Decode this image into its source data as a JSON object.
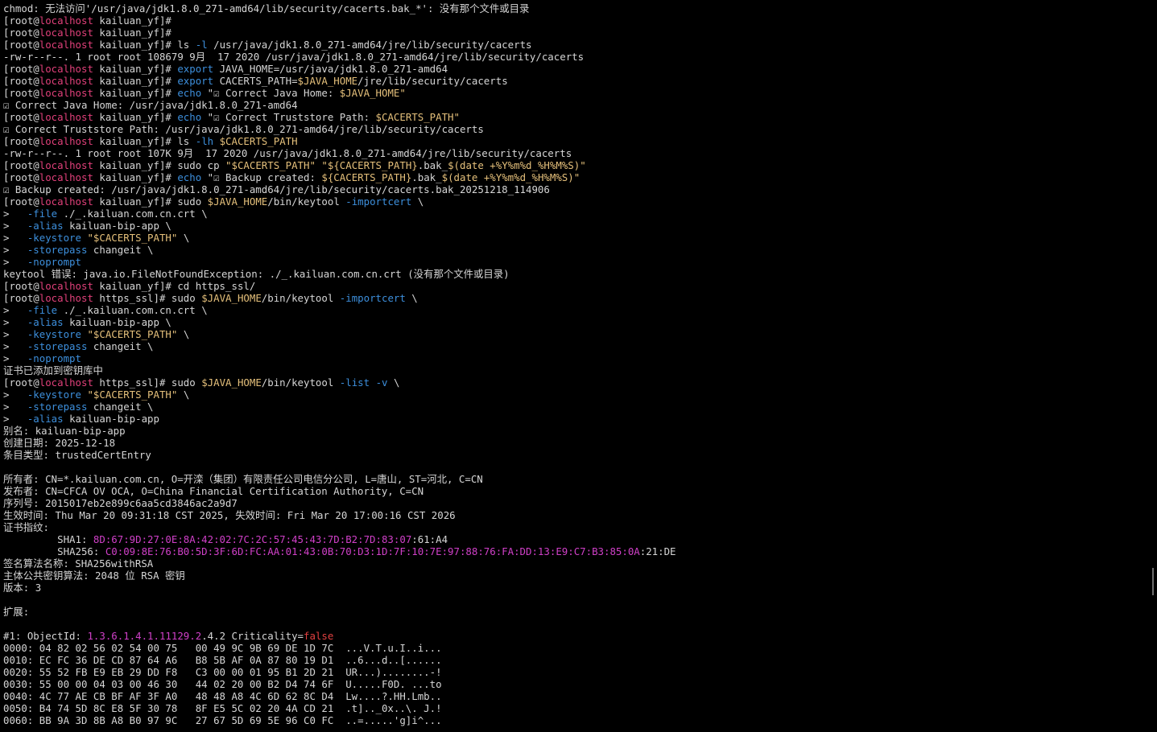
{
  "terminal": {
    "lines": [
      [
        {
          "t": "chmod: 无法访问'/usr/java/jdk1.8.0_271-amd64/lib/security/cacerts.bak_*': 没有那个文件或目录"
        }
      ],
      [
        {
          "t": "[root@"
        },
        {
          "t": "localhost",
          "c": "host"
        },
        {
          "t": " kailuan_yf]#"
        }
      ],
      [
        {
          "t": "[root@"
        },
        {
          "t": "localhost",
          "c": "host"
        },
        {
          "t": " kailuan_yf]#"
        }
      ],
      [
        {
          "t": "[root@"
        },
        {
          "t": "localhost",
          "c": "host"
        },
        {
          "t": " kailuan_yf]# ls "
        },
        {
          "t": "-l",
          "c": "cmd"
        },
        {
          "t": " /usr/java/jdk1.8.0_271-amd64/jre/lib/security/cacerts"
        }
      ],
      [
        {
          "t": "-rw-r--r--. 1 root root 108679 9月  17 2020 /usr/java/jdk1.8.0_271-amd64/jre/lib/security/cacerts"
        }
      ],
      [
        {
          "t": "[root@"
        },
        {
          "t": "localhost",
          "c": "host"
        },
        {
          "t": " kailuan_yf]# "
        },
        {
          "t": "export",
          "c": "cmd"
        },
        {
          "t": " JAVA_HOME=/usr/java/jdk1.8.0_271-amd64"
        }
      ],
      [
        {
          "t": "[root@"
        },
        {
          "t": "localhost",
          "c": "host"
        },
        {
          "t": " kailuan_yf]# "
        },
        {
          "t": "export",
          "c": "cmd"
        },
        {
          "t": " CACERTS_PATH="
        },
        {
          "t": "$JAVA_HOME",
          "c": "var"
        },
        {
          "t": "/jre/lib/security/cacerts"
        }
      ],
      [
        {
          "t": "[root@"
        },
        {
          "t": "localhost",
          "c": "host"
        },
        {
          "t": " kailuan_yf]# "
        },
        {
          "t": "echo",
          "c": "cmd"
        },
        {
          "t": " \"☑ Correct Java Home: "
        },
        {
          "t": "$JAVA_HOME\"",
          "c": "str"
        }
      ],
      [
        {
          "t": "☑ Correct Java Home: /usr/java/jdk1.8.0_271-amd64"
        }
      ],
      [
        {
          "t": "[root@"
        },
        {
          "t": "localhost",
          "c": "host"
        },
        {
          "t": " kailuan_yf]# "
        },
        {
          "t": "echo",
          "c": "cmd"
        },
        {
          "t": " \"☑ Correct Truststore Path: "
        },
        {
          "t": "$CACERTS_PATH\"",
          "c": "str"
        }
      ],
      [
        {
          "t": "☑ Correct Truststore Path: /usr/java/jdk1.8.0_271-amd64/jre/lib/security/cacerts"
        }
      ],
      [
        {
          "t": "[root@"
        },
        {
          "t": "localhost",
          "c": "host"
        },
        {
          "t": " kailuan_yf]# ls "
        },
        {
          "t": "-lh",
          "c": "cmd"
        },
        {
          "t": " "
        },
        {
          "t": "$CACERTS_PATH",
          "c": "var"
        }
      ],
      [
        {
          "t": "-rw-r--r--. 1 root root 107K 9月  17 2020 /usr/java/jdk1.8.0_271-amd64/jre/lib/security/cacerts"
        }
      ],
      [
        {
          "t": "[root@"
        },
        {
          "t": "localhost",
          "c": "host"
        },
        {
          "t": " kailuan_yf]# sudo cp "
        },
        {
          "t": "\"$CACERTS_PATH\"",
          "c": "str"
        },
        {
          "t": " "
        },
        {
          "t": "\"${CACERTS_PATH}",
          "c": "str"
        },
        {
          "t": ".bak_"
        },
        {
          "t": "$(date +%Y%m%d_%H%M%S)\"",
          "c": "str"
        }
      ],
      [
        {
          "t": "[root@"
        },
        {
          "t": "localhost",
          "c": "host"
        },
        {
          "t": " kailuan_yf]# "
        },
        {
          "t": "echo",
          "c": "cmd"
        },
        {
          "t": " \"☑ Backup created: "
        },
        {
          "t": "${CACERTS_PATH}",
          "c": "str"
        },
        {
          "t": ".bak_"
        },
        {
          "t": "$(date +%Y%m%d_%H%M%S)\"",
          "c": "str"
        }
      ],
      [
        {
          "t": "☑ Backup created: /usr/java/jdk1.8.0_271-amd64/jre/lib/security/cacerts.bak_20251218_114906"
        }
      ],
      [
        {
          "t": "[root@"
        },
        {
          "t": "localhost",
          "c": "host"
        },
        {
          "t": " kailuan_yf]# sudo "
        },
        {
          "t": "$JAVA_HOME",
          "c": "var"
        },
        {
          "t": "/bin/keytool "
        },
        {
          "t": "-importcert",
          "c": "cmd"
        },
        {
          "t": " \\"
        }
      ],
      [
        {
          "t": ">   "
        },
        {
          "t": "-file",
          "c": "cmd"
        },
        {
          "t": " ./_.kailuan.com.cn.crt \\"
        }
      ],
      [
        {
          "t": ">   "
        },
        {
          "t": "-alias",
          "c": "cmd"
        },
        {
          "t": " kailuan-bip-app \\"
        }
      ],
      [
        {
          "t": ">   "
        },
        {
          "t": "-keystore",
          "c": "cmd"
        },
        {
          "t": " "
        },
        {
          "t": "\"$CACERTS_PATH\"",
          "c": "str"
        },
        {
          "t": " \\"
        }
      ],
      [
        {
          "t": ">   "
        },
        {
          "t": "-storepass",
          "c": "cmd"
        },
        {
          "t": " changeit \\"
        }
      ],
      [
        {
          "t": ">   "
        },
        {
          "t": "-noprompt",
          "c": "cmd"
        }
      ],
      [
        {
          "t": "keytool 错误: java.io.FileNotFoundException: ./_.kailuan.com.cn.crt (没有那个文件或目录)"
        }
      ],
      [
        {
          "t": "[root@"
        },
        {
          "t": "localhost",
          "c": "host"
        },
        {
          "t": " kailuan_yf]# cd https_ssl/"
        }
      ],
      [
        {
          "t": "[root@"
        },
        {
          "t": "localhost",
          "c": "host"
        },
        {
          "t": " https_ssl]# sudo "
        },
        {
          "t": "$JAVA_HOME",
          "c": "var"
        },
        {
          "t": "/bin/keytool "
        },
        {
          "t": "-importcert",
          "c": "cmd"
        },
        {
          "t": " \\"
        }
      ],
      [
        {
          "t": ">   "
        },
        {
          "t": "-file",
          "c": "cmd"
        },
        {
          "t": " ./_.kailuan.com.cn.crt \\"
        }
      ],
      [
        {
          "t": ">   "
        },
        {
          "t": "-alias",
          "c": "cmd"
        },
        {
          "t": " kailuan-bip-app \\"
        }
      ],
      [
        {
          "t": ">   "
        },
        {
          "t": "-keystore",
          "c": "cmd"
        },
        {
          "t": " "
        },
        {
          "t": "\"$CACERTS_PATH\"",
          "c": "str"
        },
        {
          "t": " \\"
        }
      ],
      [
        {
          "t": ">   "
        },
        {
          "t": "-storepass",
          "c": "cmd"
        },
        {
          "t": " changeit \\"
        }
      ],
      [
        {
          "t": ">   "
        },
        {
          "t": "-noprompt",
          "c": "cmd"
        }
      ],
      [
        {
          "t": "证书已添加到密钥库中"
        }
      ],
      [
        {
          "t": "[root@"
        },
        {
          "t": "localhost",
          "c": "host"
        },
        {
          "t": " https_ssl]# sudo "
        },
        {
          "t": "$JAVA_HOME",
          "c": "var"
        },
        {
          "t": "/bin/keytool "
        },
        {
          "t": "-list",
          "c": "cmd"
        },
        {
          "t": " "
        },
        {
          "t": "-v",
          "c": "cmd"
        },
        {
          "t": " \\"
        }
      ],
      [
        {
          "t": ">   "
        },
        {
          "t": "-keystore",
          "c": "cmd"
        },
        {
          "t": " "
        },
        {
          "t": "\"$CACERTS_PATH\"",
          "c": "str"
        },
        {
          "t": " \\"
        }
      ],
      [
        {
          "t": ">   "
        },
        {
          "t": "-storepass",
          "c": "cmd"
        },
        {
          "t": " changeit \\"
        }
      ],
      [
        {
          "t": ">   "
        },
        {
          "t": "-alias",
          "c": "cmd"
        },
        {
          "t": " kailuan-bip-app"
        }
      ],
      [
        {
          "t": "别名: kailuan-bip-app"
        }
      ],
      [
        {
          "t": "创建日期: 2025-12-18"
        }
      ],
      [
        {
          "t": "条目类型: trustedCertEntry"
        }
      ],
      [
        {
          "t": ""
        }
      ],
      [
        {
          "t": "所有者: CN=*.kailuan.com.cn, O=开滦（集团）有限责任公司电信分公司, L=唐山, ST=河北, C=CN"
        }
      ],
      [
        {
          "t": "发布者: CN=CFCA OV OCA, O=China Financial Certification Authority, C=CN"
        }
      ],
      [
        {
          "t": "序列号: 2015017eb2e899c6aa5cd3846ac2a9d7"
        }
      ],
      [
        {
          "t": "生效时间: Thu Mar 20 09:31:18 CST 2025, 失效时间: Fri Mar 20 17:00:16 CST 2026"
        }
      ],
      [
        {
          "t": "证书指纹:"
        }
      ],
      [
        {
          "t": "         SHA1: "
        },
        {
          "t": "8D:67:9D:27:0E:8A:42:02:7C:2C:57:45:43:7D:B2:7D:83:07",
          "c": "mag"
        },
        {
          "t": ":61:A4"
        }
      ],
      [
        {
          "t": "         SHA256: "
        },
        {
          "t": "C0:09:8E:76:B0:5D:3F:6D:FC:AA:01:43:0B:70:D3:1D:7F:10:7E:97:88:76:FA:DD:13:E9:C7:B3:85:0A",
          "c": "mag"
        },
        {
          "t": ":21:DE"
        }
      ],
      [
        {
          "t": "签名算法名称: SHA256withRSA"
        }
      ],
      [
        {
          "t": "主体公共密钥算法: 2048 位 RSA 密钥"
        }
      ],
      [
        {
          "t": "版本: 3"
        }
      ],
      [
        {
          "t": ""
        }
      ],
      [
        {
          "t": "扩展:"
        }
      ],
      [
        {
          "t": ""
        }
      ],
      [
        {
          "t": "#1: ObjectId: "
        },
        {
          "t": "1.3.6.1.4.1.11129.2",
          "c": "mag"
        },
        {
          "t": ".4.2 Criticality="
        },
        {
          "t": "false",
          "c": "red"
        }
      ],
      [
        {
          "t": "0000: 04 82 02 56 02 54 00 75   00 49 9C 9B 69 DE 1D 7C  ...V.T.u.I..i..."
        }
      ],
      [
        {
          "t": "0010: EC FC 36 DE CD 87 64 A6   B8 5B AF 0A 87 80 19 D1  ..6...d..[......"
        }
      ],
      [
        {
          "t": "0020: 55 52 FB E9 EB 29 DD F8   C3 00 00 01 95 B1 2D 21  UR...)........-!"
        }
      ],
      [
        {
          "t": "0030: 55 00 00 04 03 00 46 30   44 02 20 00 B2 D4 74 6F  U.....F0D. ...to"
        }
      ],
      [
        {
          "t": "0040: 4C 77 AE CB BF AF 3F A0   48 48 A8 4C 6D 62 8C D4  Lw....?.HH.Lmb.."
        }
      ],
      [
        {
          "t": "0050: B4 74 5D 8C E8 5F 30 78   8F E5 5C 02 20 4A CD 21  .t].._0x..\\. J.!"
        }
      ],
      [
        {
          "t": "0060: BB 9A 3D 8B A8 B0 97 9C   27 67 5D 69 5E 96 C0 FC  ..=.....'g]i^..."
        }
      ]
    ]
  }
}
